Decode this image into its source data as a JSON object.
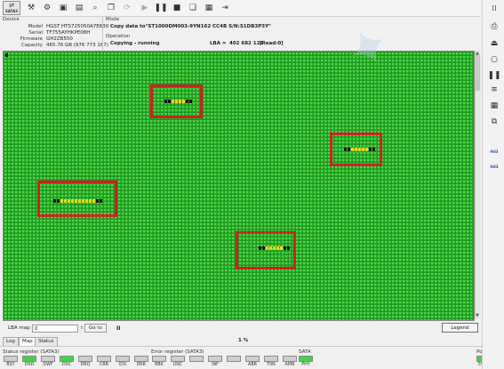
{
  "toolbar": {
    "port_label": "SATA3",
    "icons": [
      "port-icon",
      "tools-icon",
      "settings-icon",
      "save-icon",
      "open-icon",
      "search-icon",
      "copy-icon",
      "refresh-icon",
      "play-icon",
      "pause-icon",
      "stop-icon",
      "pages-icon",
      "report-icon",
      "exit-icon"
    ]
  },
  "device": {
    "header": "Device",
    "model_label": "Model",
    "model": "HGST HTS725050A7E630",
    "serial_label": "Serial",
    "serial": "TF755AYHKPE08H",
    "firmware_label": "Firmware",
    "firmware": "GH2ZB550",
    "capacity_label": "Capacity",
    "capacity": "465.76 GB (976 773 167)"
  },
  "mode": {
    "header": "Mode",
    "text": "Copy data to\"ST1000DM003-9YN162 CC4B S/N:S1DB3P3Y\""
  },
  "operation": {
    "header": "Operation",
    "status": "Copying - running",
    "lba_label": "LBA =",
    "lba_value": "402 682 129",
    "read_status": "[Read:0]"
  },
  "map_controls": {
    "lba_map_label": "LBA map",
    "lba_input_value": "0",
    "goto_label": "Go to",
    "pause_glyph": "II",
    "legend_label": "Legend"
  },
  "tabs": [
    {
      "label": "Log",
      "active": false
    },
    {
      "label": "Map",
      "active": true
    },
    {
      "label": "Status",
      "active": false
    }
  ],
  "progress_text": "1 %",
  "status_register": {
    "title": "Status register (SATA3)",
    "flags": [
      {
        "name": "BSY",
        "on": false
      },
      {
        "name": "DRD",
        "on": true
      },
      {
        "name": "DWF",
        "on": false
      },
      {
        "name": "DSC",
        "on": true
      },
      {
        "name": "DRQ",
        "on": false
      },
      {
        "name": "CRR",
        "on": false
      },
      {
        "name": "IDX",
        "on": false
      },
      {
        "name": "ERR",
        "on": false
      }
    ]
  },
  "error_register": {
    "title": "Error register (SATA3)",
    "flags": [
      {
        "name": "BBK",
        "on": false
      },
      {
        "name": "UNC",
        "on": false
      },
      {
        "name": "",
        "on": false
      },
      {
        "name": "INF",
        "on": false
      },
      {
        "name": "",
        "on": false
      },
      {
        "name": "ABR",
        "on": false
      },
      {
        "name": "T0N",
        "on": false
      },
      {
        "name": "AMN",
        "on": false
      }
    ]
  },
  "sata": {
    "title": "SATA",
    "flags": [
      {
        "name": "PHY",
        "on": true
      }
    ]
  },
  "power": {
    "title": "Power",
    "flags": [
      {
        "name": "5V",
        "on": true
      },
      {
        "name": "12V",
        "on": true
      }
    ]
  },
  "right_tools": {
    "items": [
      "grid-icon",
      "capture-icon",
      "eject-icon",
      "drive-icon",
      "pause-icon",
      "bars-icon",
      "sectors-icon",
      "clone-icon"
    ],
    "tag_labels": [
      "Hd3",
      "Hd3"
    ]
  },
  "colors": {
    "map_ok": "#27b027",
    "bad": "#111111",
    "slow": "#f3d21a",
    "highlight": "#cc2222",
    "led_on": "#3fd63f"
  }
}
